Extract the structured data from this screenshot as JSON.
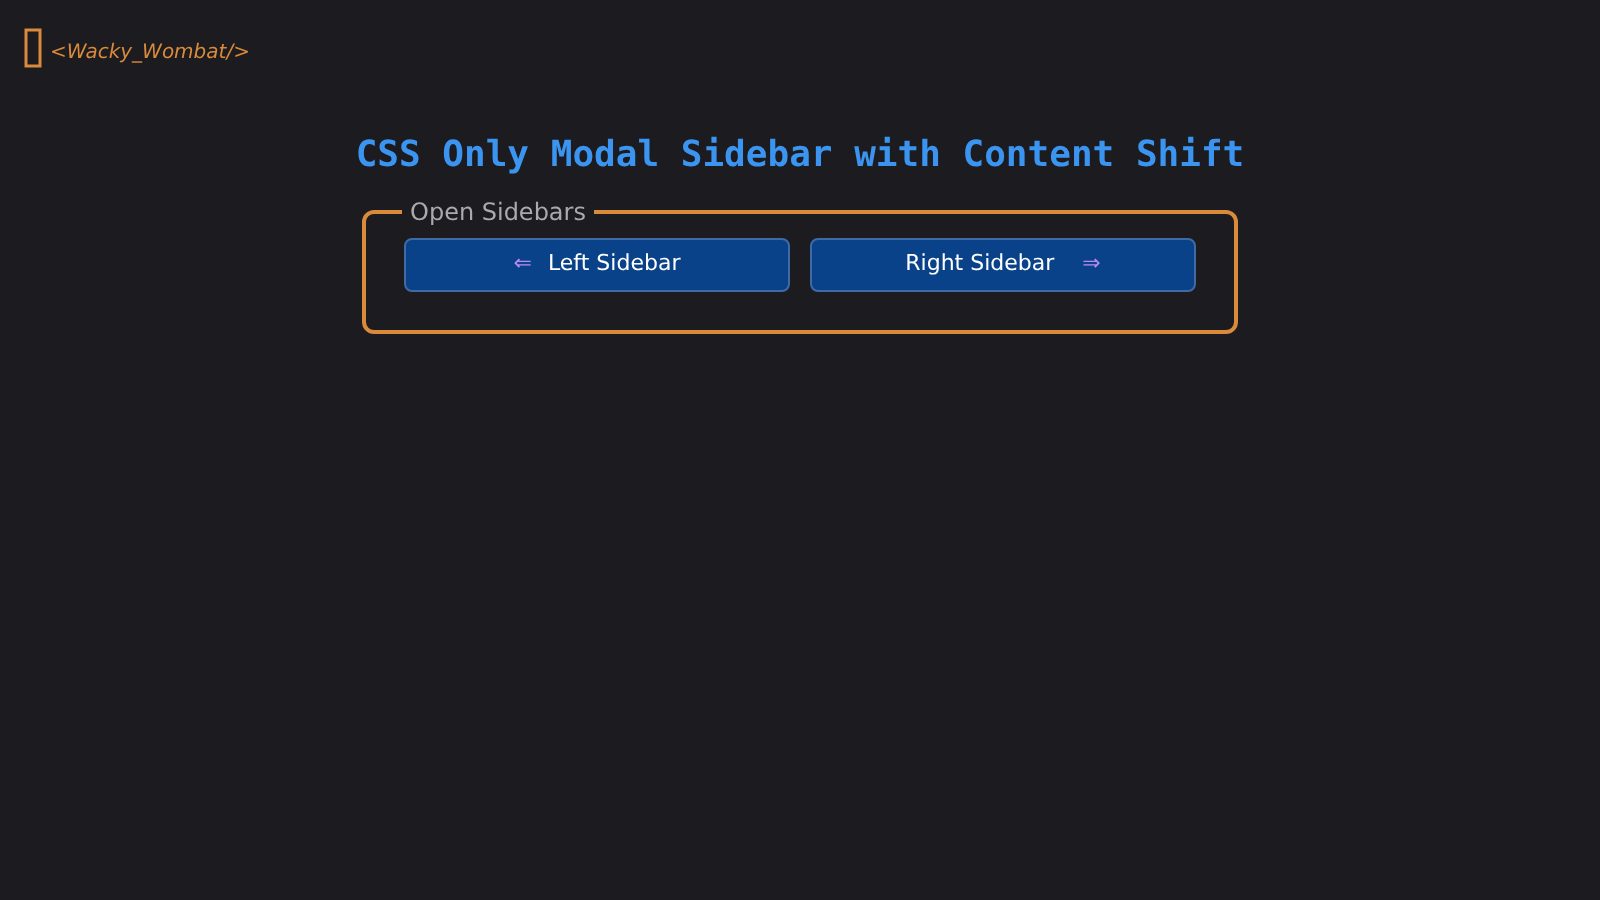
{
  "logo": {
    "text": "<Wacky_Wombat/>"
  },
  "title": "CSS Only Modal Sidebar with Content Shift",
  "group": {
    "legend": "Open Sidebars",
    "buttons": [
      {
        "label": "Left Sidebar",
        "arrow": "⇐",
        "kind": "leading"
      },
      {
        "label": "Right Sidebar",
        "arrow": "⇒",
        "kind": "trailing"
      }
    ]
  }
}
